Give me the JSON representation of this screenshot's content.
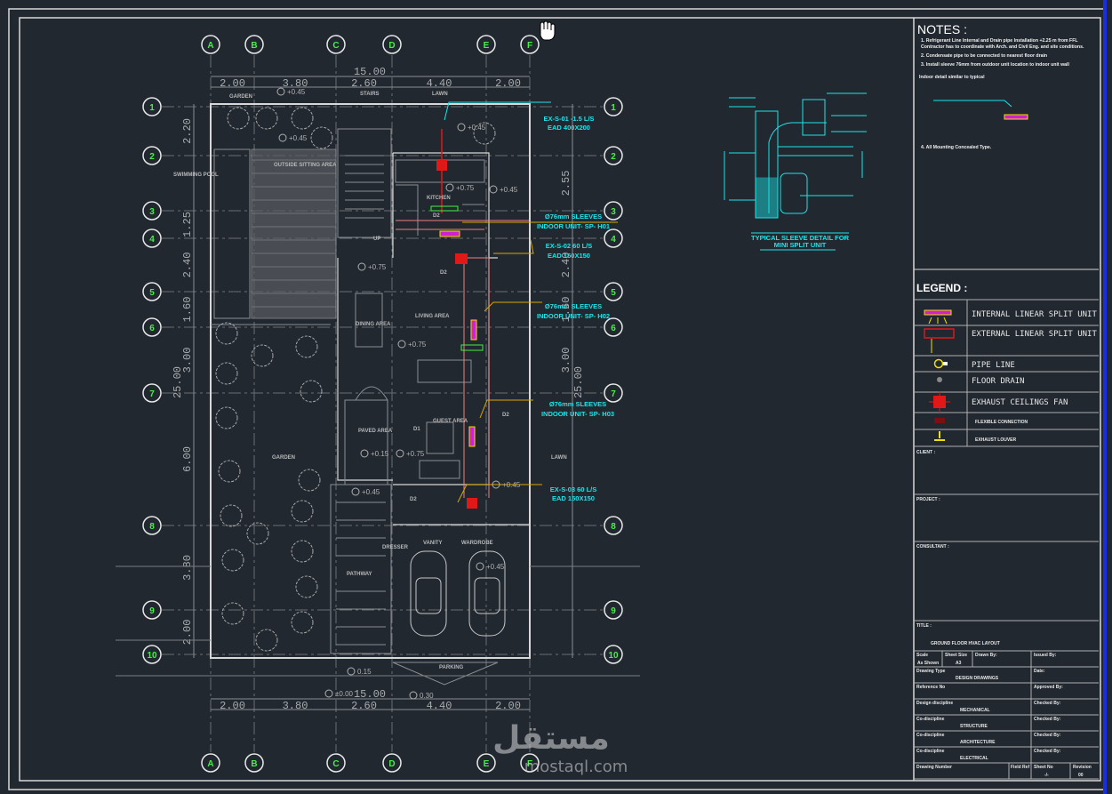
{
  "grid": {
    "columns": [
      "A",
      "B",
      "C",
      "D",
      "E",
      "F"
    ],
    "rows": [
      "1",
      "2",
      "3",
      "4",
      "5",
      "6",
      "7",
      "8",
      "9",
      "10"
    ]
  },
  "dimensions": {
    "top": [
      "2.00",
      "3.80",
      "2.60",
      "4.40",
      "2.00"
    ],
    "top_total": "15.00",
    "bottom": [
      "2.00",
      "3.80",
      "2.60",
      "4.40",
      "2.00"
    ],
    "bottom_total": "15.00",
    "left": [
      "2.20",
      "1.25",
      "2.40",
      "1.60",
      "3.00",
      "6.00",
      "3.80",
      "2.00"
    ],
    "left_total": "25.00",
    "right": [
      "2.55",
      "2.40",
      "1.60",
      "3.00"
    ],
    "right_total": "25.00"
  },
  "rooms": {
    "garden_top": "GARDEN",
    "stairs": "STAIRS",
    "lawn_top": "LAWN",
    "swimming_pool": "SWIMMING POOL",
    "outside_sitting": "OUTSIDE SITTING AREA",
    "kitchen": "KITCHEN",
    "living": "LIVING AREA",
    "dining": "DINING AREA",
    "paved": "PAVED AREA",
    "guest": "GUEST AREA",
    "garden": "GARDEN",
    "lawn": "LAWN",
    "vanity": "VANITY",
    "wardrobe": "WARDROBE",
    "dresser": "DRESSER",
    "pathway": "PATHWAY",
    "parking": "PARKING",
    "up": "UP",
    "d1": "D1",
    "d2": "D2",
    "d3": "D2",
    "d4": "D2",
    "d5": "D2"
  },
  "levels": [
    "+0.45",
    "+0.45",
    "+0.75",
    "+0.45",
    "+0.45",
    "+0.75",
    "+0.75",
    "+0.75",
    "+0.15",
    "+0.45",
    "+0.45",
    "+0.45",
    "0.15",
    "±0.00",
    "0.30"
  ],
  "hvac_labels": {
    "ex1_a": "EX-S-01 -1.5 L/S",
    "ex1_b": "EAD 400X200",
    "sl1_a": "Ø76mm SLEEVES",
    "sl1_b": "INDOOR UNIT- SP- H01",
    "ex2_a": "EX-S-02 60 L/S",
    "ex2_b": "EAD 150X150",
    "sl2_a": "Ø76mm SLEEVES",
    "sl2_b": "INDOOR UNIT- SP- H02",
    "sl3_a": "Ø76mm SLEEVES",
    "sl3_b": "INDOOR UNIT- SP- H03",
    "ex3_a": "EX-S-03 60 L/S",
    "ex3_b": "EAD 150X150"
  },
  "detail": {
    "title_1": "TYPICAL SLEEVE DETAIL FOR",
    "title_2": "MINI SPLIT UNIT"
  },
  "notes": {
    "heading": "NOTES :",
    "items": [
      "1. Refrigerant Line Internal and Drain pipe Installation +2.25 m from FFL",
      "Contractor has to coordinate with Arch. and Civil Eng. and site conditions.",
      "2. Condensate pipe to be connected to nearest floor drain",
      "3. Install sleeve 76mm from outdoor unit location to indoor unit wall"
    ],
    "detail_note": "Indoor detail similar to typical",
    "item4": "4. All Mounting Concealed Type."
  },
  "legend": {
    "heading": "LEGEND :",
    "items": [
      {
        "icon": "internal-linear-split-unit-icon",
        "label": "INTERNAL LINEAR SPLIT UNIT"
      },
      {
        "icon": "external-linear-split-unit-icon",
        "label": "EXTERNAL LINEAR SPLIT UNIT"
      },
      {
        "icon": "pipe-line-icon",
        "label": "PIPE LINE"
      },
      {
        "icon": "floor-drain-icon",
        "label": "FLOOR DRAIN"
      },
      {
        "icon": "exhaust-fan-icon",
        "label": "EXHAUST CEILINGS FAN"
      },
      {
        "icon": "flexible-connection-icon",
        "label": "FLEXIBLE CONNECTION"
      },
      {
        "icon": "exhaust-louver-icon",
        "label": "EXHAUST LOUVER"
      }
    ]
  },
  "title_block": {
    "client": "CLIENT :",
    "project": "PROJECT :",
    "consultant": "CONSULTANT :",
    "title_label": "TITLE :",
    "title": "GROUND FLOOR HVAC LAYOUT",
    "scale_label": "Scale",
    "scale": "As Shown",
    "sheet_size_label": "Sheet Size",
    "sheet_size": "A3",
    "drawn_by": "Drawn By:",
    "issued_by": "Issued By:",
    "drawing_type_label": "Drawing Type",
    "drawing_type": "DESIGN DRAWINGS",
    "date": "Date:",
    "reference": "Reference No",
    "approved": "Approved By:",
    "design_discipline": "Design discipline",
    "design_value": "MECHANICAL",
    "checked": "Checked By:",
    "co1_label": "Co-discipline",
    "co1": "STRUCTURE",
    "co1_by": "Checked By:",
    "co2_label": "Co-discipline",
    "co2": "ARCHITECTURE",
    "co2_by": "Checked By:",
    "co3_label": "Co-discipline",
    "co3": "ELECTRICAL",
    "co3_by": "Checked By:",
    "drawing_number": "Drawing Number",
    "field_ref": "Field Ref",
    "sheet_no_label": "Sheet No",
    "sheet_no": "-/-",
    "revision_label": "Revision",
    "revision": "00"
  },
  "watermark": {
    "arabic": "مستقل",
    "latin": "mostaql.com"
  },
  "colors": {
    "background": "#212830",
    "cyan": "#19e6ea",
    "green": "#46f046",
    "red": "#e01818",
    "yellow": "#e8c000",
    "magenta": "#d020d0"
  }
}
